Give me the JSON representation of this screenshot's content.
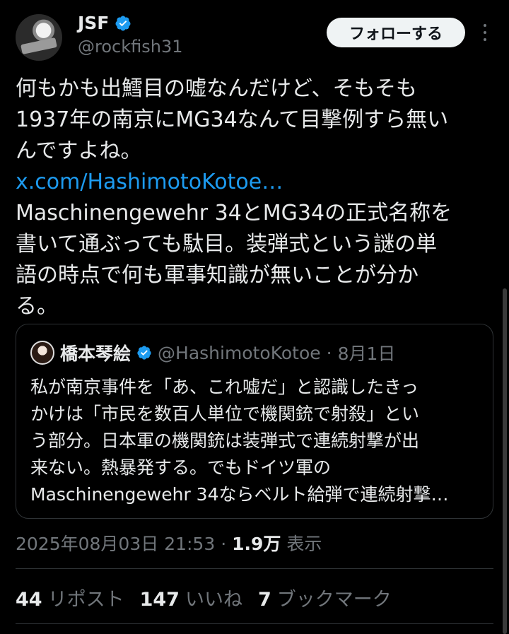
{
  "author": {
    "name": "JSF",
    "handle": "@rockfish31",
    "verified_color": "#1d9bf0"
  },
  "follow_button_label": "フォローする",
  "tweet": {
    "line1": "何もかも出鱈目の嘘なんだけど、そもそも\n1937年の南京にMG34なんて目撃例すら無い\nんですよね。",
    "link": "x.com/HashimotoKotoe…",
    "line2": "Maschinengewehr 34とMG34の正式名称を\n書いて通ぶっても駄目。装弾式という謎の単\n語の時点で何も軍事知識が無いことが分か\nる。"
  },
  "quote": {
    "name": "橋本琴絵",
    "handle": "@HashimotoKotoe",
    "separator": "·",
    "date": "8月1日",
    "text": "私が南京事件を「あ、これ嘘だ」と認識したきっ\nかけは「市民を数百人単位で機関銃で射殺」とい\nう部分。日本軍の機関銃は装弾式で連続射撃が出\n来ない。熱暴発する。でもドイツ軍の\nMaschinengewehr 34ならベルト給弾で連続射撃…"
  },
  "meta": {
    "datetime": "2025年08月03日 21:53",
    "dot": "·",
    "views_count": "1.9万",
    "views_label": "表示"
  },
  "stats": {
    "reposts_count": "44",
    "reposts_label": "リポスト",
    "likes_count": "147",
    "likes_label": "いいね",
    "bookmarks_count": "7",
    "bookmarks_label": "ブックマーク"
  },
  "icons": {
    "verified": "verified-badge-icon",
    "more": "more-options-icon"
  }
}
